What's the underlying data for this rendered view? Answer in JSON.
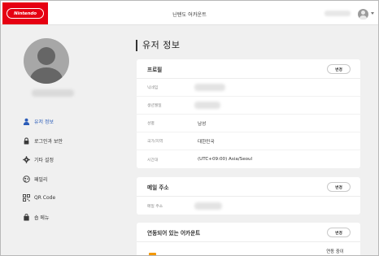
{
  "header": {
    "logo_text": "Nintendo",
    "title": "닌텐도 어카운트",
    "colors": {
      "brand_red": "#e60012"
    },
    "user_menu_icon": "chevron-down-icon"
  },
  "sidebar": {
    "items": [
      {
        "label": "유저 정보",
        "icon": "user-icon",
        "active": true
      },
      {
        "label": "로그인과 보안",
        "icon": "lock-icon",
        "active": false
      },
      {
        "label": "기타 설정",
        "icon": "gear-icon",
        "active": false
      },
      {
        "label": "패밀리",
        "icon": "family-icon",
        "active": false
      },
      {
        "label": "QR Code",
        "icon": "qr-code-icon",
        "active": false
      },
      {
        "label": "숍 메뉴",
        "icon": "shopping-bag-icon",
        "active": false
      }
    ],
    "active_color": "#2b5cb8"
  },
  "main": {
    "page_title": "유저 정보",
    "profile": {
      "title": "프로필",
      "edit_label": "변경",
      "rows": [
        {
          "label": "닉네임",
          "value": ""
        },
        {
          "label": "생년월일",
          "value": ""
        },
        {
          "label": "성별",
          "value": "남성"
        },
        {
          "label": "국가/지역",
          "value": "대한민국"
        },
        {
          "label": "시간대",
          "value": "(UTC+09:00) Asia/Seoul"
        }
      ]
    },
    "email": {
      "title": "메일 주소",
      "edit_label": "변경",
      "rows": [
        {
          "label": "메일 주소",
          "value": ""
        }
      ]
    },
    "linked_accounts": {
      "title": "연동되어 있는 어카운트",
      "edit_label": "변경",
      "status_text": "연동 중이"
    }
  }
}
